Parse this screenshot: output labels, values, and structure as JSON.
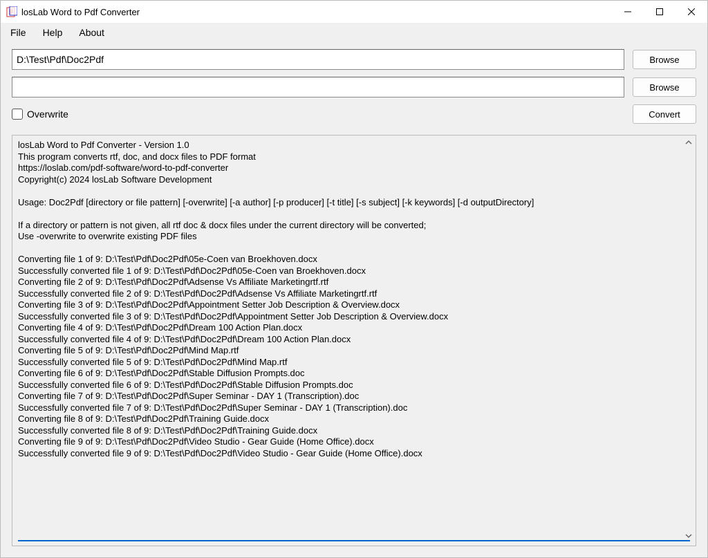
{
  "window": {
    "title": "losLab Word to Pdf Converter"
  },
  "menu": {
    "file": "File",
    "help": "Help",
    "about": "About"
  },
  "inputs": {
    "source_path": "D:\\Test\\Pdf\\Doc2Pdf",
    "dest_path": ""
  },
  "buttons": {
    "browse1": "Browse",
    "browse2": "Browse",
    "convert": "Convert"
  },
  "checkbox": {
    "overwrite_label": "Overwrite"
  },
  "log": "losLab Word to Pdf Converter - Version 1.0\nThis program converts rtf, doc, and docx files to PDF format\nhttps://loslab.com/pdf-software/word-to-pdf-converter\nCopyright(c) 2024 losLab Software Development\n\nUsage: Doc2Pdf [directory or file pattern] [-overwrite] [-a author] [-p producer] [-t title] [-s subject] [-k keywords] [-d outputDirectory]\n\nIf a directory or pattern is not given, all rtf doc & docx files under the current directory will be converted;\nUse -overwrite to overwrite existing PDF files\n\nConverting file 1 of 9: D:\\Test\\Pdf\\Doc2Pdf\\05e-Coen van Broekhoven.docx\nSuccessfully converted file 1 of 9: D:\\Test\\Pdf\\Doc2Pdf\\05e-Coen van Broekhoven.docx\nConverting file 2 of 9: D:\\Test\\Pdf\\Doc2Pdf\\Adsense Vs Affiliate Marketingrtf.rtf\nSuccessfully converted file 2 of 9: D:\\Test\\Pdf\\Doc2Pdf\\Adsense Vs Affiliate Marketingrtf.rtf\nConverting file 3 of 9: D:\\Test\\Pdf\\Doc2Pdf\\Appointment Setter Job Description & Overview.docx\nSuccessfully converted file 3 of 9: D:\\Test\\Pdf\\Doc2Pdf\\Appointment Setter Job Description & Overview.docx\nConverting file 4 of 9: D:\\Test\\Pdf\\Doc2Pdf\\Dream 100 Action Plan.docx\nSuccessfully converted file 4 of 9: D:\\Test\\Pdf\\Doc2Pdf\\Dream 100 Action Plan.docx\nConverting file 5 of 9: D:\\Test\\Pdf\\Doc2Pdf\\Mind Map.rtf\nSuccessfully converted file 5 of 9: D:\\Test\\Pdf\\Doc2Pdf\\Mind Map.rtf\nConverting file 6 of 9: D:\\Test\\Pdf\\Doc2Pdf\\Stable Diffusion Prompts.doc\nSuccessfully converted file 6 of 9: D:\\Test\\Pdf\\Doc2Pdf\\Stable Diffusion Prompts.doc\nConverting file 7 of 9: D:\\Test\\Pdf\\Doc2Pdf\\Super Seminar - DAY 1 (Transcription).doc\nSuccessfully converted file 7 of 9: D:\\Test\\Pdf\\Doc2Pdf\\Super Seminar - DAY 1 (Transcription).doc\nConverting file 8 of 9: D:\\Test\\Pdf\\Doc2Pdf\\Training Guide.docx\nSuccessfully converted file 8 of 9: D:\\Test\\Pdf\\Doc2Pdf\\Training Guide.docx\nConverting file 9 of 9: D:\\Test\\Pdf\\Doc2Pdf\\Video Studio - Gear Guide (Home Office).docx\nSuccessfully converted file 9 of 9: D:\\Test\\Pdf\\Doc2Pdf\\Video Studio - Gear Guide (Home Office).docx\n"
}
